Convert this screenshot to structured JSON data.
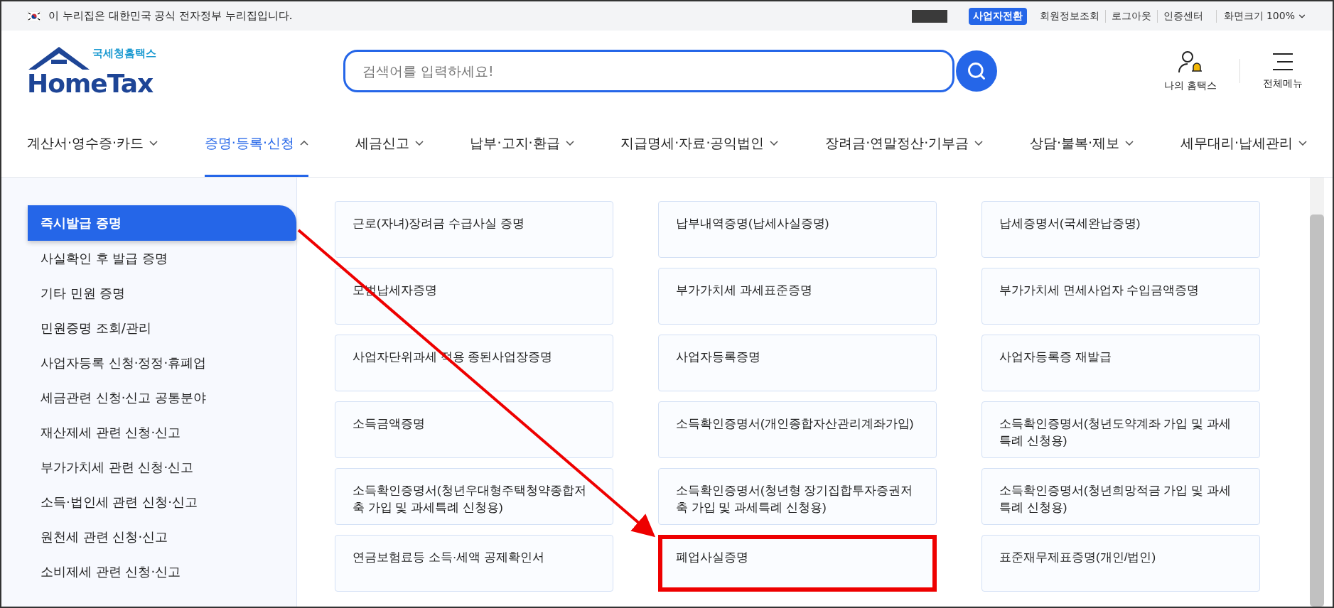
{
  "top_bar": {
    "notice": "이 누리집은 대한민국 공식 전자정부 누리집입니다.",
    "switch_button": "사업자전환",
    "links": [
      "회원정보조회",
      "로그아웃",
      "인증센터"
    ],
    "zoom_label": "화면크기 100%"
  },
  "header": {
    "logo": {
      "subtitle": "국세청홈택스",
      "title": "HomeTax"
    },
    "search": {
      "placeholder": "검색어를 입력하세요!"
    },
    "my_hometax": "나의 홈택스",
    "all_menu": "전체메뉴"
  },
  "nav": [
    {
      "label": "계산서·영수증·카드",
      "selected": false
    },
    {
      "label": "증명·등록·신청",
      "selected": true
    },
    {
      "label": "세금신고",
      "selected": false
    },
    {
      "label": "납부·고지·환급",
      "selected": false
    },
    {
      "label": "지급명세·자료·공익법인",
      "selected": false
    },
    {
      "label": "장려금·연말정산·기부금",
      "selected": false
    },
    {
      "label": "상담·불복·제보",
      "selected": false
    },
    {
      "label": "세무대리·납세관리",
      "selected": false
    }
  ],
  "sidebar": {
    "items": [
      {
        "label": "즉시발급 증명",
        "selected": true
      },
      {
        "label": "사실확인 후 발급 증명",
        "selected": false
      },
      {
        "label": "기타 민원 증명",
        "selected": false
      },
      {
        "label": "민원증명 조회/관리",
        "selected": false
      },
      {
        "label": "사업자등록 신청·정정·휴폐업",
        "selected": false
      },
      {
        "label": "세금관련 신청·신고 공통분야",
        "selected": false
      },
      {
        "label": "재산제세 관련 신청·신고",
        "selected": false
      },
      {
        "label": "부가가치세 관련 신청·신고",
        "selected": false
      },
      {
        "label": "소득·법인세 관련 신청·신고",
        "selected": false
      },
      {
        "label": "원천세 관련 신청·신고",
        "selected": false
      },
      {
        "label": "소비제세 관련 신청·신고",
        "selected": false
      }
    ]
  },
  "cards": [
    {
      "label": "근로(자녀)장려금 수급사실 증명",
      "highlighted": false
    },
    {
      "label": "납부내역증명(납세사실증명)",
      "highlighted": false
    },
    {
      "label": "납세증명서(국세완납증명)",
      "highlighted": false
    },
    {
      "label": "모범납세자증명",
      "highlighted": false
    },
    {
      "label": "부가가치세 과세표준증명",
      "highlighted": false
    },
    {
      "label": "부가가치세 면세사업자 수입금액증명",
      "highlighted": false
    },
    {
      "label": "사업자단위과세 적용 종된사업장증명",
      "highlighted": false
    },
    {
      "label": "사업자등록증명",
      "highlighted": false
    },
    {
      "label": "사업자등록증 재발급",
      "highlighted": false
    },
    {
      "label": "소득금액증명",
      "highlighted": false
    },
    {
      "label": "소득확인증명서(개인종합자산관리계좌가입)",
      "highlighted": false
    },
    {
      "label": "소득확인증명서(청년도약계좌 가입 및 과세특례 신청용)",
      "highlighted": false
    },
    {
      "label": "소득확인증명서(청년우대형주택청약종합저축 가입 및 과세특례 신청용)",
      "highlighted": false
    },
    {
      "label": "소득확인증명서(청년형 장기집합투자증권저축 가입 및 과세특례 신청용)",
      "highlighted": false
    },
    {
      "label": "소득확인증명서(청년희망적금 가입 및 과세특례 신청용)",
      "highlighted": false
    },
    {
      "label": "연금보험료등 소득·세액 공제확인서",
      "highlighted": false
    },
    {
      "label": "폐업사실증명",
      "highlighted": true
    },
    {
      "label": "표준재무제표증명(개인/법인)",
      "highlighted": false
    }
  ]
}
